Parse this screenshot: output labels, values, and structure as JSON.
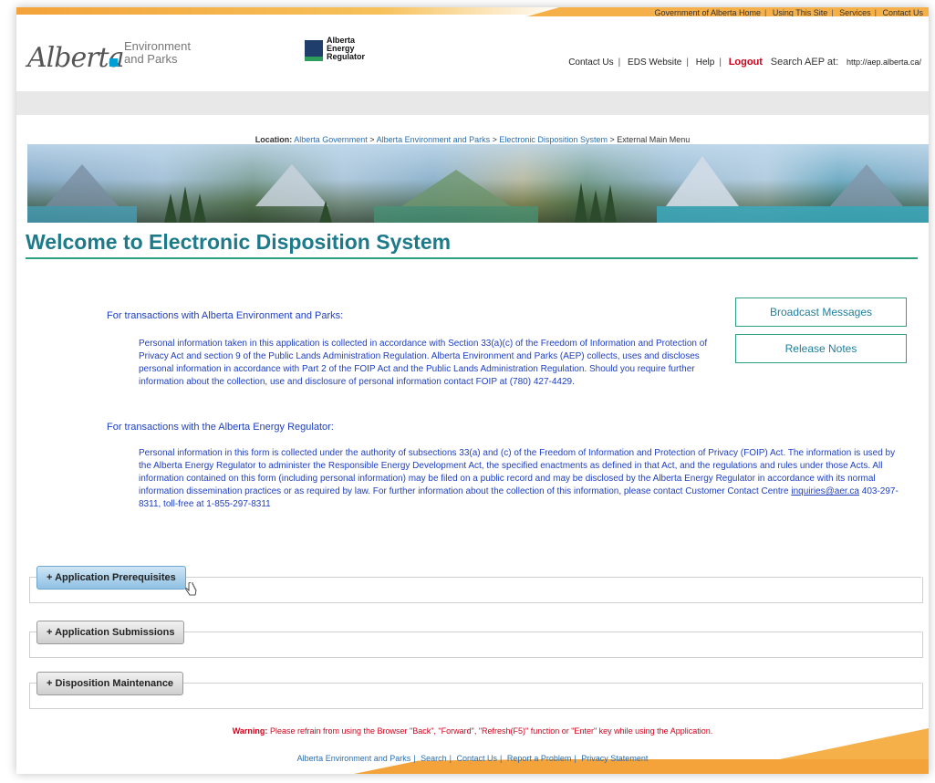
{
  "gov_links": [
    "Government of Alberta Home",
    "Using This Site",
    "Services",
    "Contact Us"
  ],
  "header": {
    "logo_word": "Alberta",
    "logo_dept_line1": "Environment",
    "logo_dept_line2": "and Parks",
    "aer_line1": "Alberta",
    "aer_line2": "Energy",
    "aer_line3": "Regulator"
  },
  "top_links": {
    "contact": "Contact Us",
    "eds": "EDS Website",
    "help": "Help",
    "logout": "Logout",
    "search_label": "Search AEP at:",
    "search_url": "http://aep.alberta.ca/"
  },
  "location": {
    "label": "Location:",
    "crumb1": "Alberta Government",
    "crumb2": "Alberta Environment and Parks",
    "crumb3": "Electronic Disposition System",
    "current": "External Main Menu"
  },
  "page_title": "Welcome to Electronic Disposition System",
  "side_buttons": {
    "broadcast": "Broadcast Messages",
    "release": "Release Notes"
  },
  "aep_section": {
    "heading": "For transactions with Alberta Environment and Parks:",
    "text": "Personal information taken in this application is collected in accordance with Section 33(a)(c) of the Freedom of Information and Protection of Privacy Act and section 9 of the Public Lands Administration Regulation. Alberta Environment and Parks (AEP) collects, uses and discloses personal information in accordance with Part 2 of the FOIP Act and the Public Lands Administration Regulation. Should you require further information about the collection, use and disclosure of personal information contact FOIP at (780) 427-4429."
  },
  "aer_section": {
    "heading": "For transactions with the Alberta Energy Regulator:",
    "text_before": "Personal information in this form is collected under the authority of subsections 33(a) and (c) of the Freedom of Information and Protection of Privacy (FOIP) Act. The information is used by the Alberta Energy Regulator to administer the Responsible Energy Development Act, the specified enactments as defined in that Act, and the regulations and rules under those Acts. All information contained on this form (including personal information) may be filed on a public record and may be disclosed by the Alberta Energy Regulator in accordance with its normal information dissemination practices or as required by law. For further information about the collection of this information, please contact Customer Contact Centre",
    "email": "inquiries@aer.ca",
    "text_after": "403-297-8311, toll-free at 1-855-297-8311"
  },
  "accordion": [
    {
      "label": "+ Application Prerequisites"
    },
    {
      "label": "+ Application Submissions"
    },
    {
      "label": "+ Disposition Maintenance"
    }
  ],
  "warning": {
    "label": "Warning:",
    "text": "Please refrain from using the Browser \"Back\", \"Forward\", \"Refresh(F5)\" function or \"Enter\" key while using the Application."
  },
  "footer_links": [
    "Alberta Environment and Parks",
    "Search",
    "Contact Us",
    "Report a Problem",
    "Privacy Statement"
  ],
  "colors": {
    "accent_teal": "#1d7a8a",
    "text_blue": "#1f3fc0",
    "warning_red": "#d0021b",
    "gov_orange": "#f3a33a"
  }
}
